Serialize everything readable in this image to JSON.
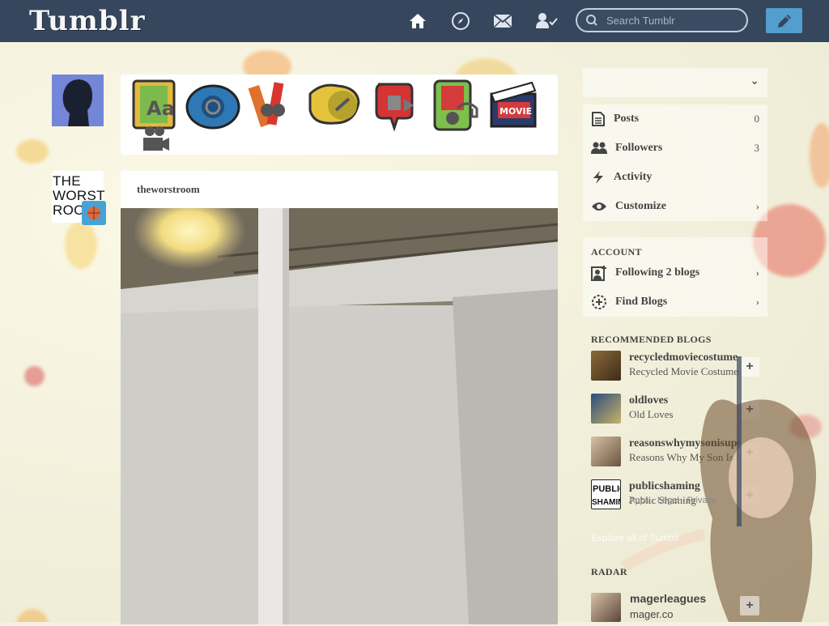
{
  "header": {
    "logo": "Tumblr",
    "search_placeholder": "Search Tumblr",
    "nav_icons": [
      "home-icon",
      "compass-icon",
      "mail-icon",
      "account-icon"
    ],
    "compose_icon": "pencil-icon"
  },
  "post_types": [
    "text",
    "photo",
    "quote",
    "link",
    "chat",
    "audio",
    "video"
  ],
  "post": {
    "blog_name": "theworstroom",
    "avatar_text": "THE WORST ROO"
  },
  "sidebar": {
    "items": [
      {
        "label": "Posts",
        "count": "0"
      },
      {
        "label": "Followers",
        "count": "3"
      },
      {
        "label": "Activity",
        "count": ""
      },
      {
        "label": "Customize",
        "count": ""
      }
    ],
    "account_heading": "ACCOUNT",
    "account_items": [
      {
        "label": "Following 2 blogs"
      },
      {
        "label": "Find Blogs"
      }
    ],
    "recommended_heading": "RECOMMENDED BLOGS",
    "recommended": [
      {
        "name": "recycledmoviecostume",
        "title": "Recycled Movie Costumes"
      },
      {
        "name": "oldloves",
        "title": "Old Loves"
      },
      {
        "name": "reasonswhymysonisupset",
        "title": "Reasons Why My Son Is Upset"
      },
      {
        "name": "publicshaming",
        "title": "Public Shaming"
      }
    ],
    "footer_links": "Apps · Legal · Privacy",
    "explore": "Explore all of Tumblr",
    "radar_heading": "RADAR",
    "radar": {
      "name": "magerleagues",
      "url": "mager.co"
    }
  },
  "colors": {
    "header_bg": "#36465d",
    "compose_bg": "#529ecc",
    "page_bg": "#f4f1df"
  }
}
